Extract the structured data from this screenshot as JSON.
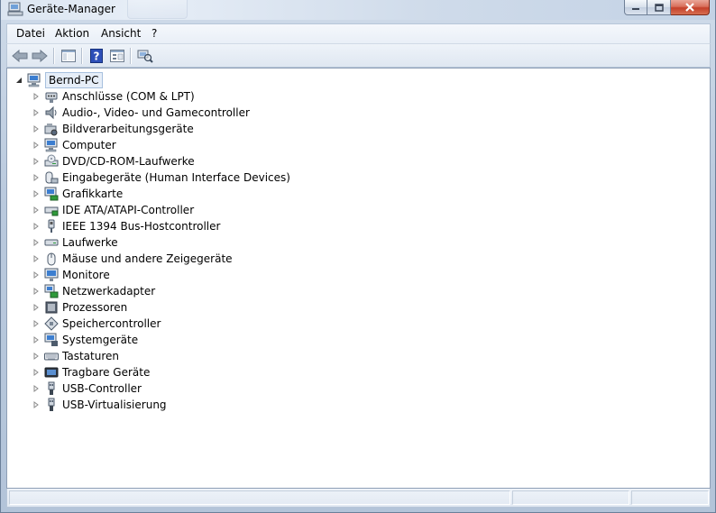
{
  "window": {
    "title": "Geräte-Manager",
    "controls": {
      "minimize": "minimize",
      "maximize": "maximize",
      "close": "close"
    }
  },
  "menu": {
    "items": [
      {
        "label": "Datei"
      },
      {
        "label": "Aktion"
      },
      {
        "label": "Ansicht"
      },
      {
        "label": "?"
      }
    ]
  },
  "toolbar": {
    "buttons": [
      {
        "icon": "back-arrow-icon"
      },
      {
        "icon": "forward-arrow-icon"
      },
      {
        "icon": "show-hide-console-tree-icon"
      },
      {
        "icon": "help-icon"
      },
      {
        "icon": "properties-icon"
      },
      {
        "icon": "scan-hardware-icon"
      }
    ]
  },
  "tree": {
    "root": {
      "label": "Bernd-PC",
      "expanded": true,
      "icon": "computer-icon"
    },
    "categories": [
      {
        "label": "Anschlüsse (COM & LPT)",
        "icon": "port-icon"
      },
      {
        "label": "Audio-, Video- und Gamecontroller",
        "icon": "speaker-icon"
      },
      {
        "label": "Bildverarbeitungsgeräte",
        "icon": "camera-icon"
      },
      {
        "label": "Computer",
        "icon": "computer-icon"
      },
      {
        "label": "DVD/CD-ROM-Laufwerke",
        "icon": "dvd-drive-icon"
      },
      {
        "label": "Eingabegeräte (Human Interface Devices)",
        "icon": "hid-icon"
      },
      {
        "label": "Grafikkarte",
        "icon": "display-adapter-icon"
      },
      {
        "label": "IDE ATA/ATAPI-Controller",
        "icon": "ide-controller-icon"
      },
      {
        "label": "IEEE 1394 Bus-Hostcontroller",
        "icon": "firewire-icon"
      },
      {
        "label": "Laufwerke",
        "icon": "disk-drive-icon"
      },
      {
        "label": "Mäuse und andere Zeigegeräte",
        "icon": "mouse-icon"
      },
      {
        "label": "Monitore",
        "icon": "monitor-icon"
      },
      {
        "label": "Netzwerkadapter",
        "icon": "network-adapter-icon"
      },
      {
        "label": "Prozessoren",
        "icon": "processor-icon"
      },
      {
        "label": "Speichercontroller",
        "icon": "storage-controller-icon"
      },
      {
        "label": "Systemgeräte",
        "icon": "system-devices-icon"
      },
      {
        "label": "Tastaturen",
        "icon": "keyboard-icon"
      },
      {
        "label": "Tragbare Geräte",
        "icon": "portable-device-icon"
      },
      {
        "label": "USB-Controller",
        "icon": "usb-icon"
      },
      {
        "label": "USB-Virtualisierung",
        "icon": "usb-icon"
      }
    ]
  },
  "statusbar": {
    "panes": [
      "",
      "",
      ""
    ]
  },
  "colors": {
    "window_frame": "#b9c9dd",
    "tree_background": "#ffffff",
    "close_button": "#c4402a",
    "selection_border": "#a7c0de"
  }
}
